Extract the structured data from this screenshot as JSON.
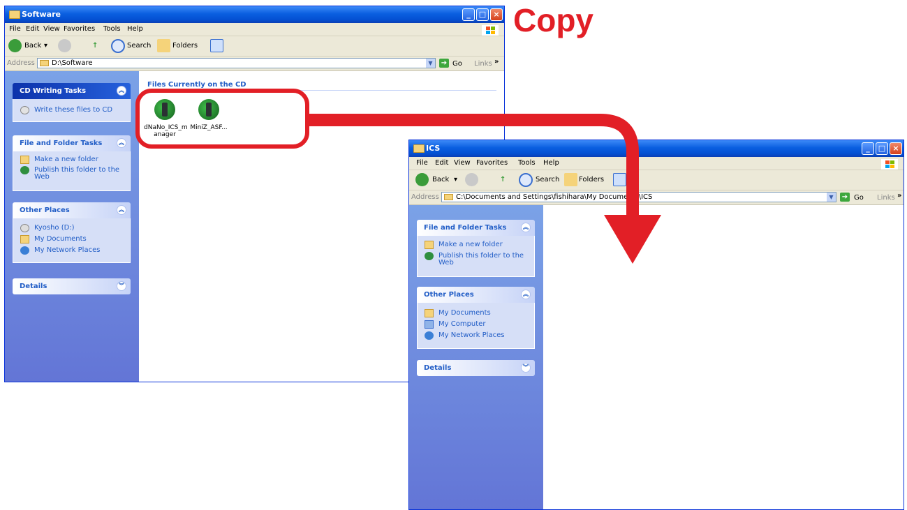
{
  "annotation": {
    "copy_label": "Copy",
    "copy_color": "#e21f26"
  },
  "window1": {
    "title": "Software",
    "menu": [
      "File",
      "Edit",
      "View",
      "Favorites",
      "Tools",
      "Help"
    ],
    "toolbar": {
      "back": "Back",
      "search": "Search",
      "folders": "Folders"
    },
    "address": {
      "label": "Address",
      "value": "D:\\Software",
      "go": "Go",
      "links": "Links",
      "more": "»"
    },
    "content_heading": "Files Currently on the CD",
    "files": [
      {
        "name": "dNaNo_ICS_manager",
        "line1": "dNaNo_ICS_m",
        "line2": "anager"
      },
      {
        "name": "MiniZ_ASF...",
        "line1": "MiniZ_ASF...",
        "line2": ""
      }
    ],
    "panels": {
      "cd_tasks": {
        "title": "CD Writing Tasks",
        "items": [
          "Write these files to CD"
        ]
      },
      "file_folder_tasks": {
        "title": "File and Folder Tasks",
        "items": [
          "Make a new folder",
          "Publish this folder to the",
          "Web"
        ]
      },
      "other_places": {
        "title": "Other Places",
        "items": [
          "Kyosho (D:)",
          "My Documents",
          "My Network Places"
        ]
      },
      "details": {
        "title": "Details"
      }
    }
  },
  "window2": {
    "title": "ICS",
    "menu": [
      "File",
      "Edit",
      "View",
      "Favorites",
      "Tools",
      "Help"
    ],
    "toolbar": {
      "back": "Back",
      "search": "Search",
      "folders": "Folders"
    },
    "address": {
      "label": "Address",
      "value": "C:\\Documents and Settings\\fishihara\\My Documents\\ICS",
      "go": "Go",
      "links": "Links",
      "more": "»"
    },
    "panels": {
      "file_folder_tasks": {
        "title": "File and Folder Tasks",
        "items": [
          "Make a new folder",
          "Publish this folder to the",
          "Web"
        ]
      },
      "other_places": {
        "title": "Other Places",
        "items": [
          "My Documents",
          "My Computer",
          "My Network Places"
        ]
      },
      "details": {
        "title": "Details"
      }
    }
  },
  "icons": {
    "panel_collapse": "collapse-chevron-icon",
    "panel_expand": "expand-chevron-icon"
  }
}
